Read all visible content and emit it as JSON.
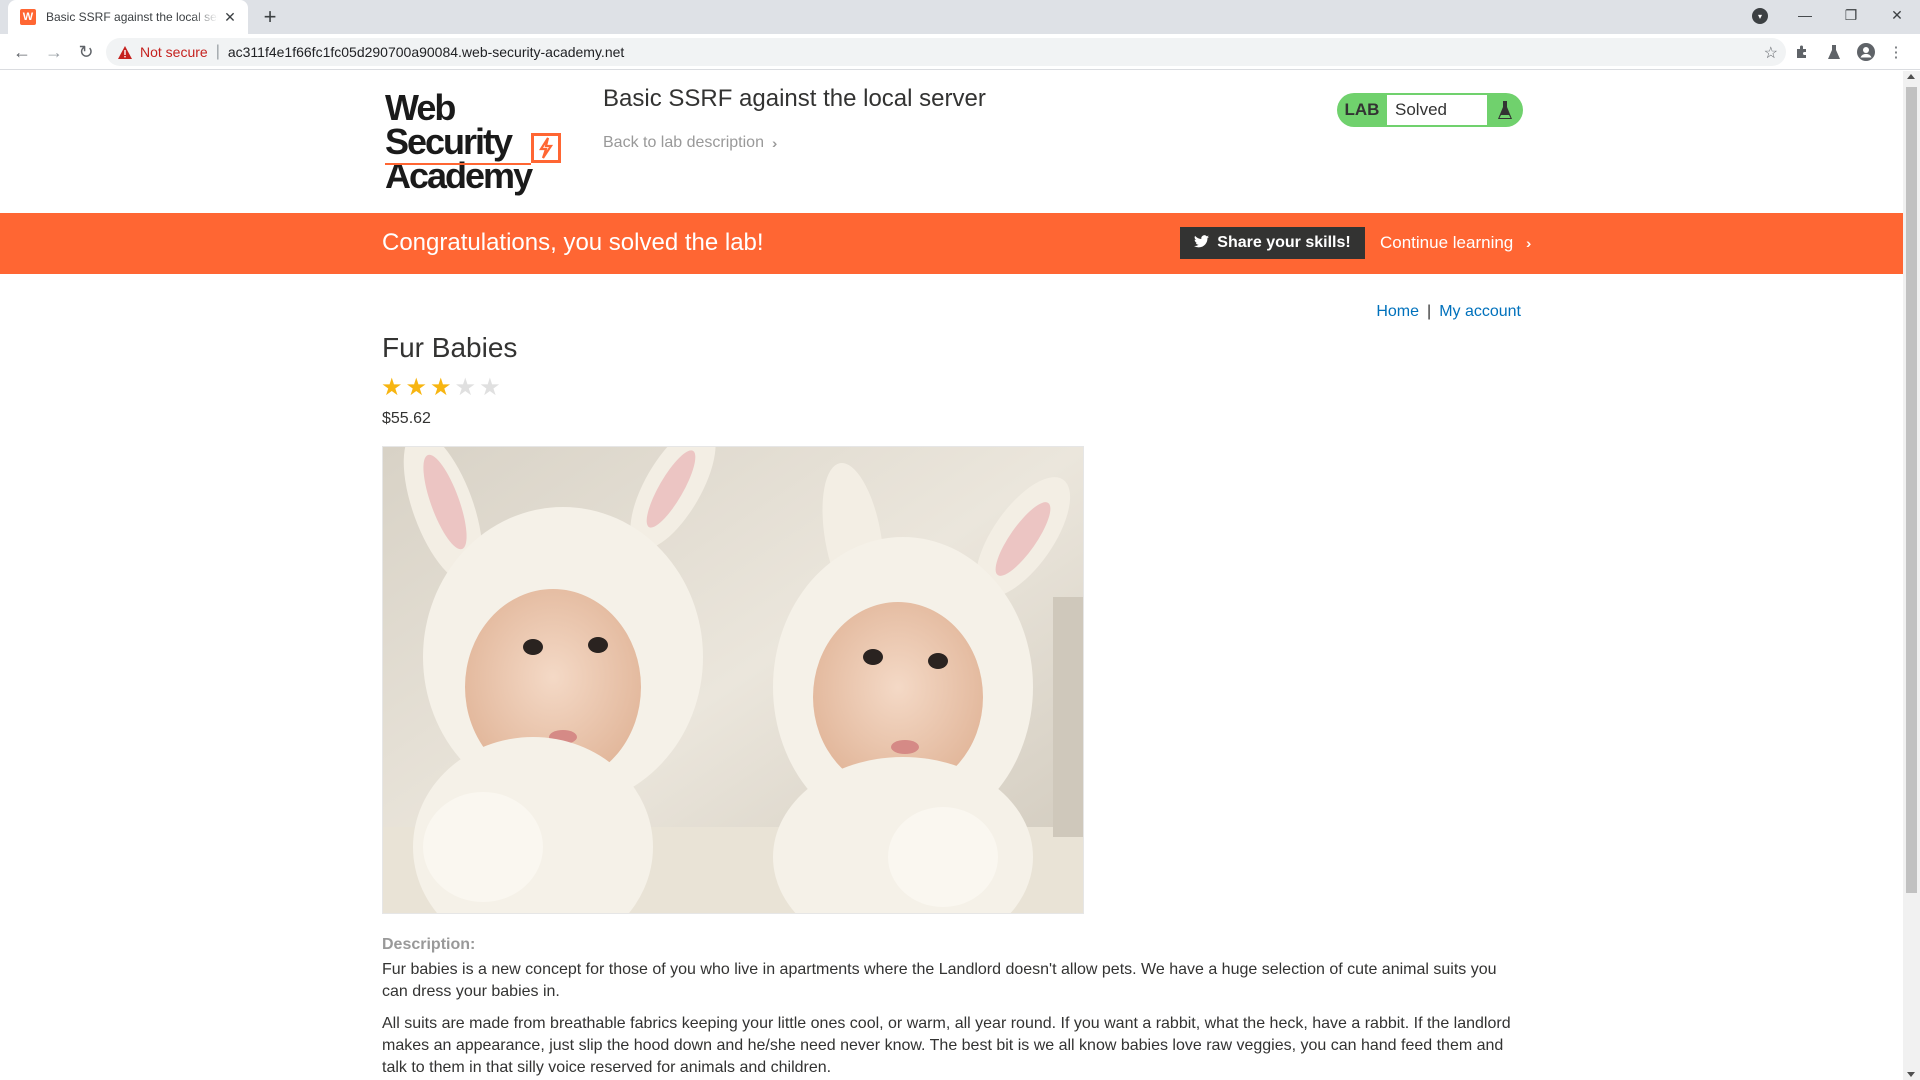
{
  "browser": {
    "tab_title": "Basic SSRF against the local serve",
    "tab_favicon_letter": "W",
    "security_label": "Not secure",
    "url": "ac311f4e1f66fc1fc05d290700a90084.web-security-academy.net"
  },
  "header": {
    "logo_line1": "Web Security",
    "logo_line2": "Academy",
    "lab_title": "Basic SSRF against the local server",
    "back_link": "Back to lab description",
    "lab_tag": "LAB",
    "lab_status": "Solved"
  },
  "banner": {
    "message": "Congratulations, you solved the lab!",
    "share_label": "Share your skills!",
    "continue_label": "Continue learning"
  },
  "nav": {
    "home": "Home",
    "separator": "|",
    "account": "My account"
  },
  "product": {
    "name": "Fur Babies",
    "rating": 3,
    "max_rating": 5,
    "price": "$55.62",
    "description_label": "Description:",
    "description_p1": "Fur babies is a new concept for those of you who live in apartments where the Landlord doesn't allow pets. We have a huge selection of cute animal suits you can dress your babies in.",
    "description_p2": "All suits are made from breathable fabrics keeping your little ones cool, or warm, all year round. If you want a rabbit, what the heck, have a rabbit. If the landlord makes an appearance, just slip the hood down and he/she need never know. The best bit is we all know babies love raw veggies, you can hand feed them and talk to them in that silly voice reserved for animals and children."
  },
  "colors": {
    "accent": "#ff6633",
    "lab_green": "#70d16d",
    "link_blue": "#0071bc",
    "star_filled": "#f7b511",
    "star_empty": "#e0e0e0"
  }
}
